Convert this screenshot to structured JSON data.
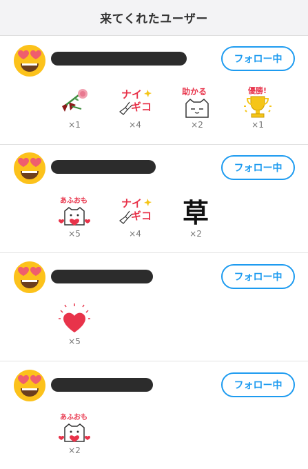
{
  "header": {
    "title": "来てくれたユーザー"
  },
  "users": [
    {
      "follow_label": "フォロー中",
      "stamps": [
        {
          "icon": "rose-ribbon-stamp",
          "count": "×1"
        },
        {
          "icon": "nice-ghikko-stamp",
          "text": "ナイ ギコ",
          "count": "×4"
        },
        {
          "icon": "tasukaru-cat-stamp",
          "text": "助かる",
          "count": "×2"
        },
        {
          "icon": "yusho-trophy-stamp",
          "text": "優勝!",
          "count": "×1"
        }
      ]
    },
    {
      "follow_label": "フォロー中",
      "stamps": [
        {
          "icon": "afuomo-heart-stamp",
          "text": "あふおも",
          "count": "×5"
        },
        {
          "icon": "nice-ghikko-stamp",
          "text": "ナイ ギコ",
          "count": "×4"
        },
        {
          "icon": "kusa-stamp",
          "text": "草",
          "count": "×2"
        }
      ]
    },
    {
      "follow_label": "フォロー中",
      "stamps": [
        {
          "icon": "red-heart-stamp",
          "count": "×5"
        }
      ]
    },
    {
      "follow_label": "フォロー中",
      "stamps": [
        {
          "icon": "afuomo-heart-stamp",
          "text": "あふおも",
          "count": "×2"
        }
      ]
    }
  ],
  "colors": {
    "accent": "#1d9bf0",
    "header_bg": "#f3f3f5",
    "avatar": "#fcc21b",
    "heart": "#e8334a"
  }
}
